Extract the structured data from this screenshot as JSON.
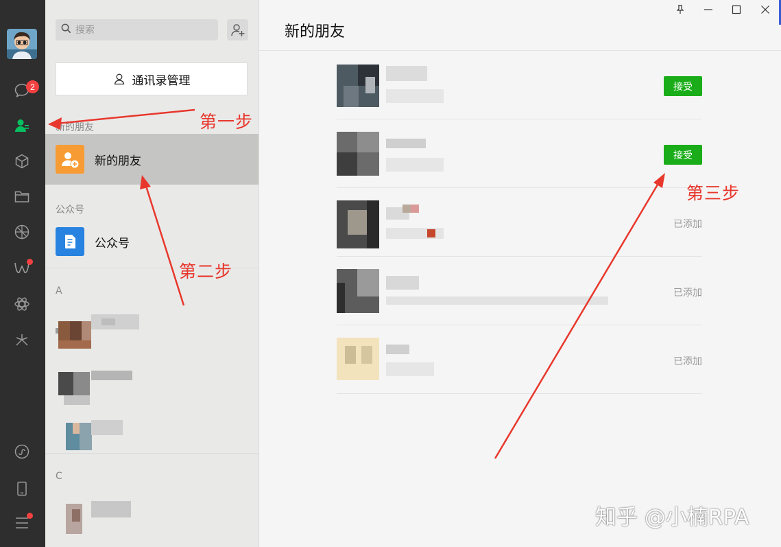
{
  "rail": {
    "chat_badge": "2",
    "icons": [
      "chat-icon",
      "contacts-icon",
      "favorites-icon",
      "files-icon",
      "moments-icon",
      "channels-icon",
      "mini-programs-icon",
      "search-discover-icon",
      "miniprogram-link-icon",
      "phone-icon",
      "menu-icon"
    ]
  },
  "sidebar": {
    "search_placeholder": "搜索",
    "manage_button": "通讯录管理",
    "section_new_friends": "新的朋友",
    "new_friends_item": "新的朋友",
    "section_official": "公众号",
    "official_item": "公众号",
    "section_a": "A",
    "section_c": "C"
  },
  "main": {
    "title": "新的朋友",
    "requests": [
      {
        "action": "接受",
        "type": "accept"
      },
      {
        "action": "接受",
        "type": "accept"
      },
      {
        "action": "已添加",
        "type": "added"
      },
      {
        "action": "已添加",
        "type": "added"
      },
      {
        "action": "已添加",
        "type": "added"
      }
    ]
  },
  "annotations": {
    "step1": "第一步",
    "step2": "第二步",
    "step3": "第三步"
  },
  "watermark": "知乎 @小楠RPA",
  "colors": {
    "accept_green": "#1aad19",
    "badge_red": "#f24141",
    "annotation_red": "#e8372c",
    "rail_bg": "#2e2e2e",
    "new_friends_orange": "#f79c34",
    "official_blue": "#2782e0"
  }
}
